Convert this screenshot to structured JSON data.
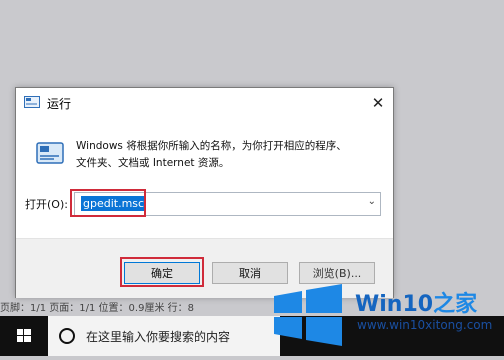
{
  "dialog": {
    "title": "运行",
    "description_line1": "Windows 将根据你所输入的名称，为你打开相应的程序、",
    "description_line2": "文件夹、文档或 Internet 资源。",
    "open_label": "打开(O):",
    "input_value": "gpedit.msc",
    "ok_label": "确定",
    "cancel_label": "取消",
    "browse_label": "浏览(B)..."
  },
  "background": {
    "status_text": "页脚：1/1  页面：1/1  位置：0.9厘米  行：8"
  },
  "taskbar": {
    "search_placeholder": "在这里输入你要搜索的内容"
  },
  "watermark": {
    "title_main": "Win10",
    "title_accent": "之家",
    "url": "www.win10xitong.com"
  },
  "colors": {
    "highlight_red": "#d02b3a",
    "selection_blue": "#0a74d6",
    "taskbar": "#101010",
    "windows_blue": "#1e88e5"
  }
}
